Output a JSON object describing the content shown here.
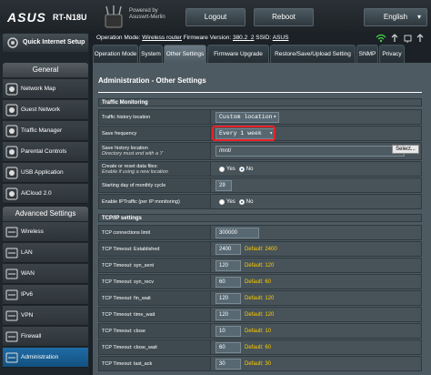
{
  "header": {
    "logo": "ASUS",
    "model": "RT-N18U",
    "powered_by": "Powered by",
    "powered_name": "Asuswrt-Merlin",
    "logout": "Logout",
    "reboot": "Reboot",
    "language": "English"
  },
  "info": {
    "op_mode_label": "Operation Mode:",
    "op_mode": "Wireless router",
    "fw_label": "Firmware Version:",
    "fw": "380.2_2",
    "ssid_label": "SSID:",
    "ssid": "ASUS"
  },
  "sidebar": {
    "qis": "Quick Internet Setup",
    "general": "General",
    "general_items": [
      "Network Map",
      "Guest Network",
      "Traffic Manager",
      "Parental Controls",
      "USB Application",
      "AiCloud 2.0"
    ],
    "advanced": "Advanced Settings",
    "advanced_items": [
      "Wireless",
      "LAN",
      "WAN",
      "IPv6",
      "VPN",
      "Firewall",
      "Administration"
    ]
  },
  "tabs": [
    "Operation Mode",
    "System",
    "Other Settings",
    "Firmware Upgrade",
    "Restore/Save/Upload Setting",
    "SNMP",
    "Privacy"
  ],
  "page": {
    "title": "Administration - Other Settings",
    "traffic": {
      "header": "Traffic Monitoring",
      "history_location_label": "Traffic history location",
      "history_location": "Custom location",
      "save_freq_label": "Save frequency",
      "save_freq": "Every 1 week",
      "save_loc_label": "Save history location",
      "save_loc_sub": "Directory must end with a '/'",
      "save_loc": "/mnt/",
      "select_btn": "Select...",
      "create_label": "Create or reset data files:",
      "create_sub": "Enable if using a new location",
      "yes": "Yes",
      "no": "No",
      "start_day_label": "Starting day of monthly cycle",
      "start_day": "29",
      "iptraffic_label": "Enable IPTraffic (per IP monitoring)"
    },
    "tcp": {
      "header": "TCP/IP settings",
      "conn_label": "TCP connections limit",
      "conn": "300000",
      "rows": [
        {
          "label": "TCP Timeout: Established",
          "value": "2400",
          "default": "Default: 2400"
        },
        {
          "label": "TCP Timeout: syn_sent",
          "value": "120",
          "default": "Default: 120"
        },
        {
          "label": "TCP Timeout: syn_recv",
          "value": "60",
          "default": "Default: 60"
        },
        {
          "label": "TCP Timeout: fin_wait",
          "value": "120",
          "default": "Default: 120"
        },
        {
          "label": "TCP Timeout: time_wait",
          "value": "120",
          "default": "Default: 120"
        },
        {
          "label": "TCP Timeout: close",
          "value": "10",
          "default": "Default: 10"
        },
        {
          "label": "TCP Timeout: close_wait",
          "value": "60",
          "default": "Default: 60"
        },
        {
          "label": "TCP Timeout: last_ack",
          "value": "30",
          "default": "Default: 30"
        }
      ]
    }
  }
}
